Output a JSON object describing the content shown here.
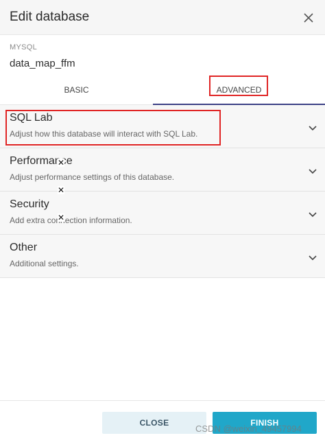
{
  "modal": {
    "title": "Edit database",
    "db_type": "MYSQL",
    "db_name": "data_map_ffm"
  },
  "tabs": [
    {
      "label": "BASIC",
      "active": false
    },
    {
      "label": "ADVANCED",
      "active": true
    }
  ],
  "panels": [
    {
      "title": "SQL Lab",
      "description": "Adjust how this database will interact with SQL Lab."
    },
    {
      "title": "Performance",
      "description": "Adjust performance settings of this database."
    },
    {
      "title": "Security",
      "description": "Add extra connection information."
    },
    {
      "title": "Other",
      "description": "Additional settings."
    }
  ],
  "footer": {
    "close_label": "CLOSE",
    "finish_label": "FINISH"
  },
  "watermark": "CSDN @weixin_49457994",
  "colors": {
    "accent": "#20a7c9",
    "tab_underline": "#3b3f84",
    "highlight_box": "#e02424"
  },
  "icons": [
    "close-icon",
    "chevron-down-icon"
  ]
}
